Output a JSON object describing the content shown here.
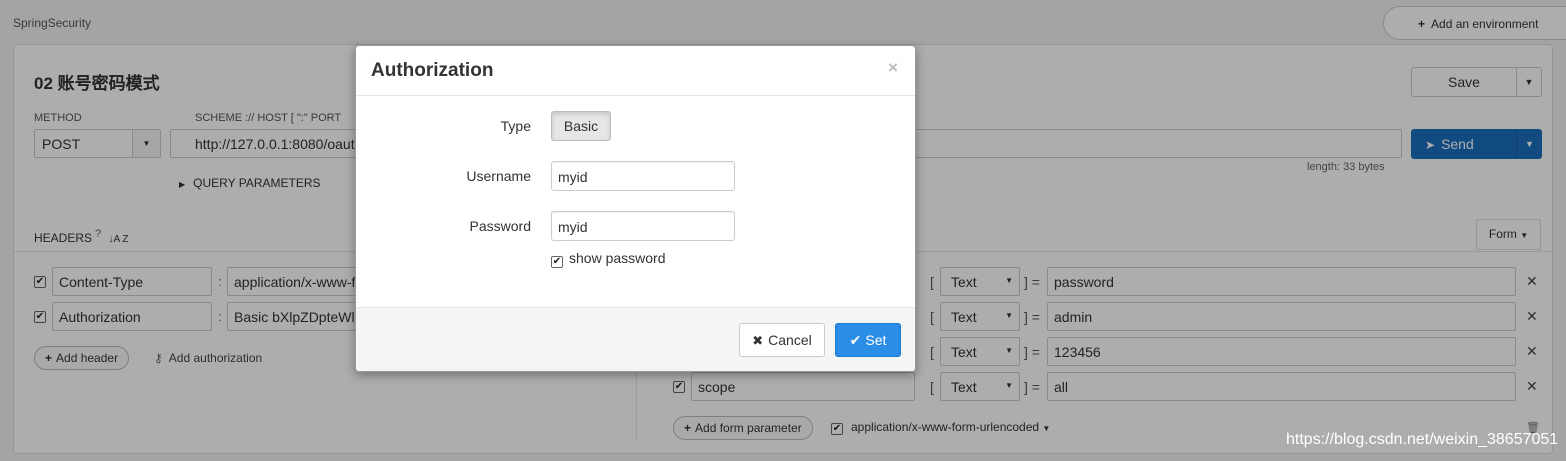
{
  "window": {
    "project_name": "SpringSecurity",
    "add_environment": "Add an environment"
  },
  "request": {
    "title": "02 账号密码模式",
    "save_label": "Save",
    "method_label": "METHOD",
    "method_value": "POST",
    "url_label": "SCHEME :// HOST [ \":\" PORT",
    "url_value": "http://127.0.0.1:8080/oaut",
    "send_label": "Send",
    "length": "length: 33 bytes",
    "query_params": "QUERY PARAMETERS"
  },
  "headers": {
    "label": "HEADERS",
    "help": "?",
    "sort_icon": "↓A Z",
    "rows": [
      {
        "name": "Content-Type",
        "value": "application/x-www-f"
      },
      {
        "name": "Authorization",
        "value": "Basic bXlpZDpteWl"
      }
    ],
    "add_header": "Add header",
    "add_authorization": "Add authorization"
  },
  "body": {
    "form_label": "Form",
    "rows": [
      {
        "name": "",
        "type": "Text",
        "value": "password"
      },
      {
        "name": "",
        "type": "Text",
        "value": "admin"
      },
      {
        "name": "",
        "type": "Text",
        "value": "123456"
      },
      {
        "name": "scope",
        "type": "Text",
        "value": "all"
      }
    ],
    "add_form_parameter": "Add form parameter",
    "content_type": "application/x-www-form-urlencoded"
  },
  "modal": {
    "title": "Authorization",
    "close": "×",
    "type_label": "Type",
    "type_value": "Basic",
    "username_label": "Username",
    "username_value": "myid",
    "password_label": "Password",
    "password_value": "myid",
    "show_password": "show password",
    "cancel": "Cancel",
    "set": "Set"
  },
  "watermark": "https://blog.csdn.net/weixin_38657051",
  "colors": {
    "primary": "#1a6fbf",
    "set_button": "#2a8ee6"
  }
}
